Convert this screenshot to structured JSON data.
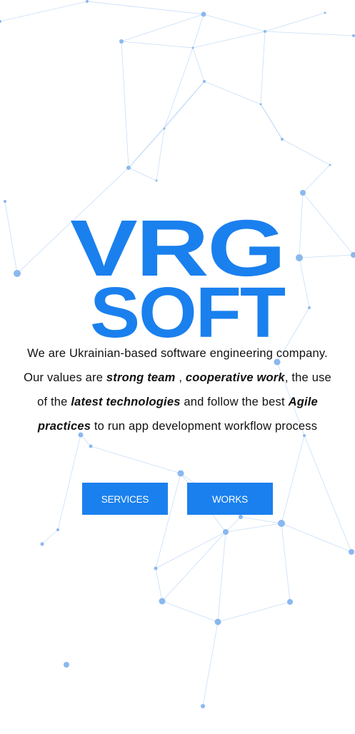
{
  "brand": {
    "logo_line1": "VRG",
    "logo_line2": "SOFT",
    "color": "#1a80ee"
  },
  "tagline": {
    "p1": "We are Ukrainian-based software engineering company. Our values are ",
    "strong_team": "strong team",
    "p2": " , ",
    "cooperative_work": "cooperative work",
    "p3": ", the use of the ",
    "latest_technologies": "latest technologies",
    "p4": " and follow the best ",
    "agile_practices": "Agile practices",
    "p5": " to run app development workflow process"
  },
  "buttons": {
    "services_label": "SERVICES",
    "works_label": "WORKS"
  },
  "colors": {
    "accent": "#1a80ee",
    "network": "#8ab8ef"
  }
}
